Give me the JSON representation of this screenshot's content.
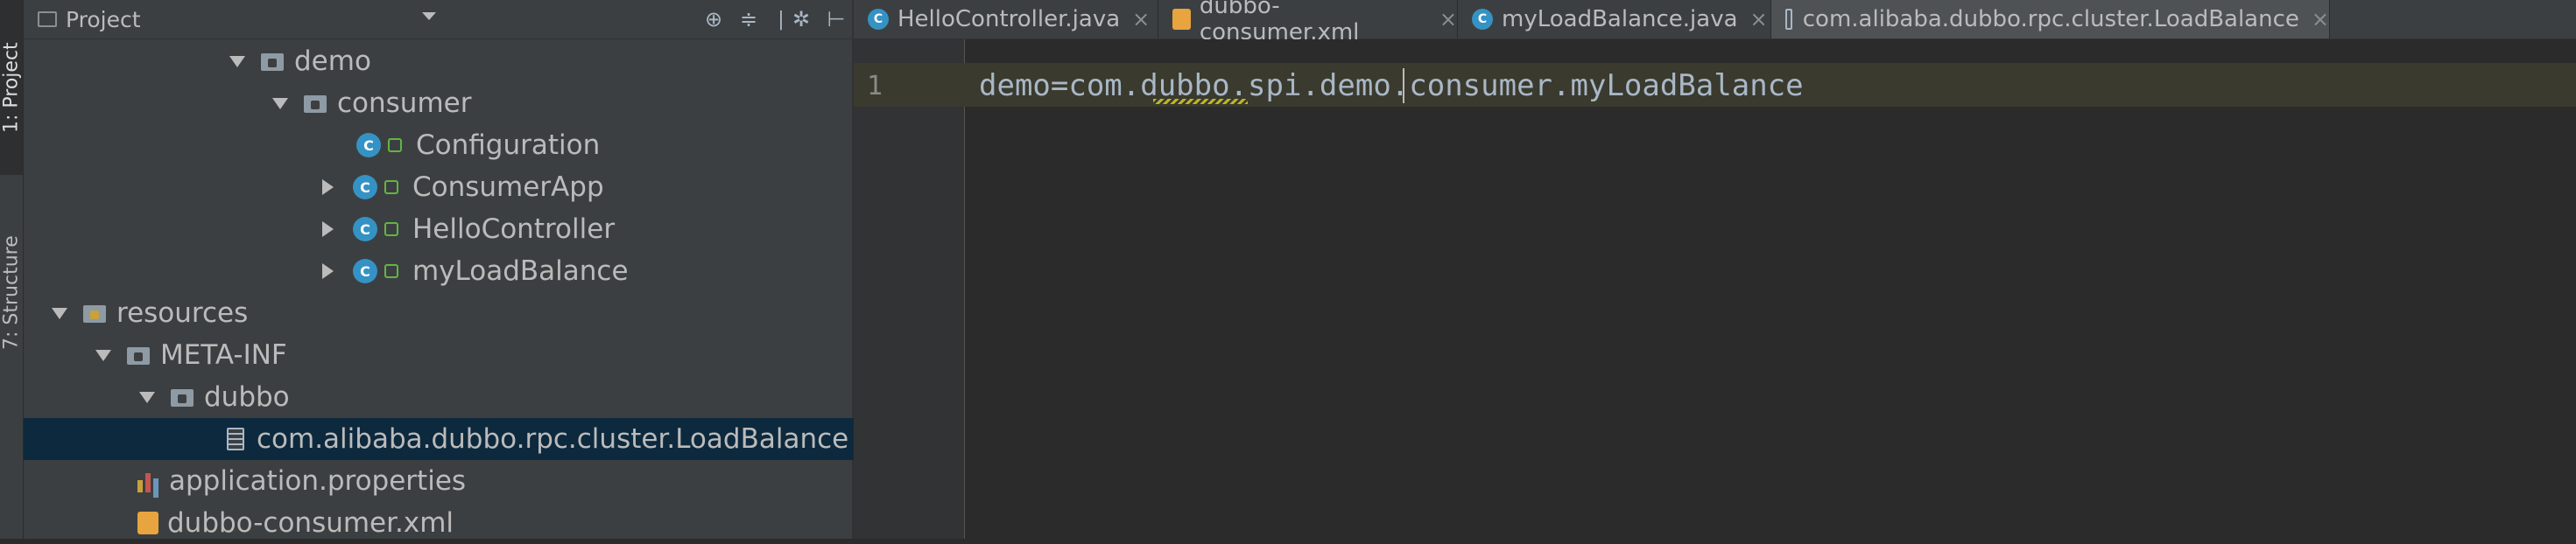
{
  "left_strip": {
    "project_tab": "1: Project",
    "structure_tab": "7: Structure"
  },
  "project_panel": {
    "title": "Project",
    "header_icons": [
      "crosshair-icon",
      "collapse-icon",
      "gear-icon",
      "hide-panel-icon"
    ]
  },
  "tree": [
    {
      "label": "demo",
      "type": "folder",
      "expanded": true
    },
    {
      "label": "consumer",
      "type": "folder",
      "expanded": true
    },
    {
      "label": "Configuration",
      "type": "class"
    },
    {
      "label": "ConsumerApp",
      "type": "class",
      "expandable": true
    },
    {
      "label": "HelloController",
      "type": "class",
      "expandable": true
    },
    {
      "label": "myLoadBalance",
      "type": "class",
      "expandable": true
    },
    {
      "label": "resources",
      "type": "resources-folder",
      "expanded": true
    },
    {
      "label": "META-INF",
      "type": "folder",
      "expanded": true
    },
    {
      "label": "dubbo",
      "type": "folder",
      "expanded": true
    },
    {
      "label": "com.alibaba.dubbo.rpc.cluster.LoadBalance",
      "type": "file",
      "selected": true
    },
    {
      "label": "application.properties",
      "type": "properties"
    },
    {
      "label": "dubbo-consumer.xml",
      "type": "xml"
    }
  ],
  "editor": {
    "tabs": [
      {
        "label": "HelloController.java",
        "type": "class"
      },
      {
        "label": "dubbo-consumer.xml",
        "type": "xml"
      },
      {
        "label": "myLoadBalance.java",
        "type": "class"
      },
      {
        "label": "com.alibaba.dubbo.rpc.cluster.LoadBalance",
        "type": "file",
        "active": true
      }
    ],
    "close_glyph": "×",
    "line_number": "1",
    "code": "demo=com.dubbo.spi.demo.consumer.myLoadBalance"
  },
  "colors": {
    "background": "#2b2b2b",
    "panel": "#3c3f41",
    "selection": "#0d293e",
    "class_icon": "#3592c4",
    "caret_line": "#3a3a2e"
  }
}
